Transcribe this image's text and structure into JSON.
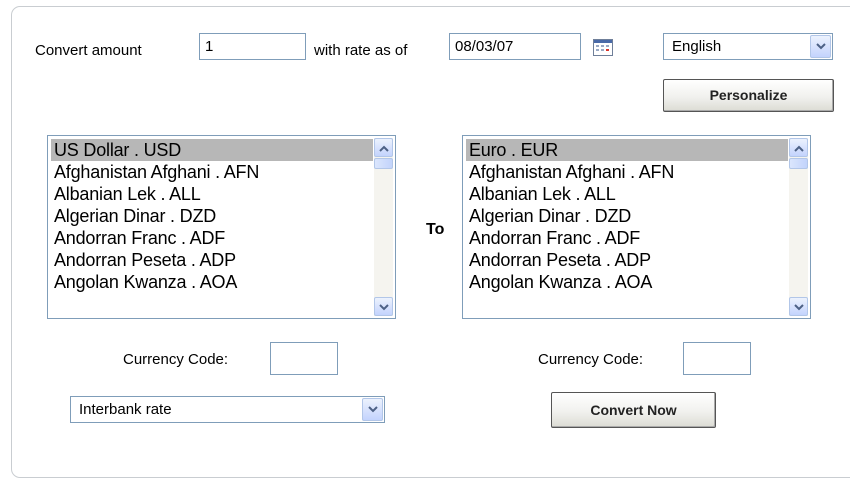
{
  "convert": {
    "amount_label": "Convert amount",
    "amount_value": "1",
    "rate_label": "with rate as of",
    "date_value": "08/03/07"
  },
  "language": {
    "selected": "English",
    "personalize_label": "Personalize"
  },
  "from_list": {
    "selected": "US Dollar . USD",
    "items": [
      "US Dollar . USD",
      "Afghanistan Afghani . AFN",
      "Albanian Lek . ALL",
      "Algerian Dinar . DZD",
      "Andorran Franc . ADF",
      "Andorran Peseta . ADP",
      "Angolan Kwanza . AOA"
    ]
  },
  "to_label": "To",
  "to_list": {
    "selected": "Euro . EUR",
    "items": [
      "Euro . EUR",
      "Afghanistan Afghani . AFN",
      "Albanian Lek . ALL",
      "Algerian Dinar . DZD",
      "Andorran Franc . ADF",
      "Andorran Peseta . ADP",
      "Angolan Kwanza . AOA"
    ]
  },
  "currency_code": {
    "from_label": "Currency Code:",
    "from_value": "",
    "to_label": "Currency Code:",
    "to_value": ""
  },
  "rate_type": {
    "selected": "Interbank rate"
  },
  "convert_button": "Convert Now",
  "icons": {
    "calendar": "calendar-icon",
    "dropdown": "chevron-down-icon",
    "scroll_up": "arrow-up-icon",
    "scroll_down": "arrow-down-icon"
  },
  "colors": {
    "border": "#7f9db9",
    "selected_item": "#b7b7b7",
    "panel_border": "#c9cdd1"
  }
}
